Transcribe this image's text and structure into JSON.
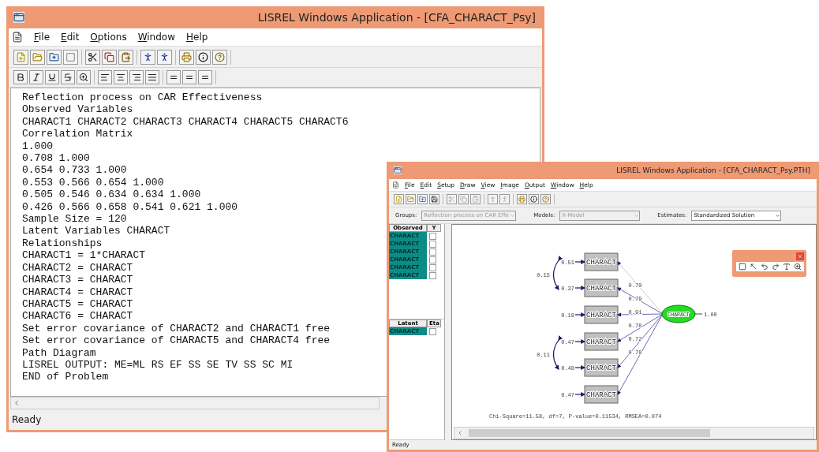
{
  "main_window": {
    "title": "LISREL Windows Application - [CFA_CHARACT_Psy]",
    "menu": [
      "File",
      "Edit",
      "Options",
      "Window",
      "Help"
    ],
    "lines": [
      "Reflection process on CAR Effectiveness",
      "Observed Variables",
      "CHARACT1 CHARACT2 CHARACT3 CHARACT4 CHARACT5 CHARACT6",
      "Correlation Matrix",
      "1.000",
      "0.708 1.000",
      "0.654 0.733 1.000",
      "0.553 0.566 0.654 1.000",
      "0.505 0.546 0.634 0.634 1.000",
      "0.426 0.566 0.658 0.541 0.621 1.000",
      "Sample Size = 120",
      "Latent Variables CHARACT",
      "Relationships",
      "CHARACT1 = 1*CHARACT",
      "CHARACT2 = CHARACT",
      "CHARACT3 = CHARACT",
      "CHARACT4 = CHARACT",
      "CHARACT5 = CHARACT",
      "CHARACT6 = CHARACT",
      "Set error covariance of CHARACT2 and CHARACT1 free",
      "Set error covariance of CHARACT5 and CHARACT4 free",
      "Path Diagram",
      "LISREL OUTPUT: ME=ML RS EF SS SE TV SS SC MI",
      "END of Problem"
    ],
    "status": "Ready"
  },
  "path_window": {
    "title": "LISREL Windows Application - [CFA_CHARACT_Psy.PTH]",
    "menu": [
      "File",
      "Edit",
      "Setup",
      "Draw",
      "View",
      "Image",
      "Output",
      "Window",
      "Help"
    ],
    "selectors": [
      {
        "label": "Groups:",
        "value": "Reflection process on CAR Effe",
        "disabled": true
      },
      {
        "label": "Models:",
        "value": "X-Model",
        "disabled": true
      },
      {
        "label": "Estimates:",
        "value": "Standardized Solution",
        "disabled": false
      }
    ],
    "observed": {
      "header": "Observed",
      "flag_header": "Y",
      "items": [
        {
          "label": "CHARACT",
          "checked": false
        },
        {
          "label": "CHARACT",
          "checked": false
        },
        {
          "label": "CHARACT",
          "checked": false
        },
        {
          "label": "CHARACT",
          "checked": false
        },
        {
          "label": "CHARACT",
          "checked": false
        },
        {
          "label": "CHARACT",
          "checked": false
        }
      ]
    },
    "latent": {
      "header": "Latent",
      "flag_header": "Eta",
      "items": [
        {
          "label": "CHARACT",
          "checked": false
        }
      ]
    },
    "diagram": {
      "observed": [
        {
          "label": "CHARACT",
          "error": "0.51",
          "loading": "0.70"
        },
        {
          "label": "CHARACT",
          "error": "0.37",
          "loading": "0.79"
        },
        {
          "label": "CHARACT",
          "error": "0.18",
          "loading": "0.91"
        },
        {
          "label": "CHARACT",
          "error": "0.47",
          "loading": "0.78"
        },
        {
          "label": "CHARACT",
          "error": "0.48",
          "loading": "0.72"
        },
        {
          "label": "CHARACT",
          "error": "0.47",
          "loading": "0.78"
        }
      ],
      "covariances": [
        {
          "value": "0.15"
        },
        {
          "value": "0.11"
        }
      ],
      "latent": {
        "label": "CHARACT",
        "variance": "1.00"
      },
      "fit": "Chi-Square=11.58, df=7, P-value=0.11534, RMSEA=0.074"
    },
    "status": "Ready"
  }
}
